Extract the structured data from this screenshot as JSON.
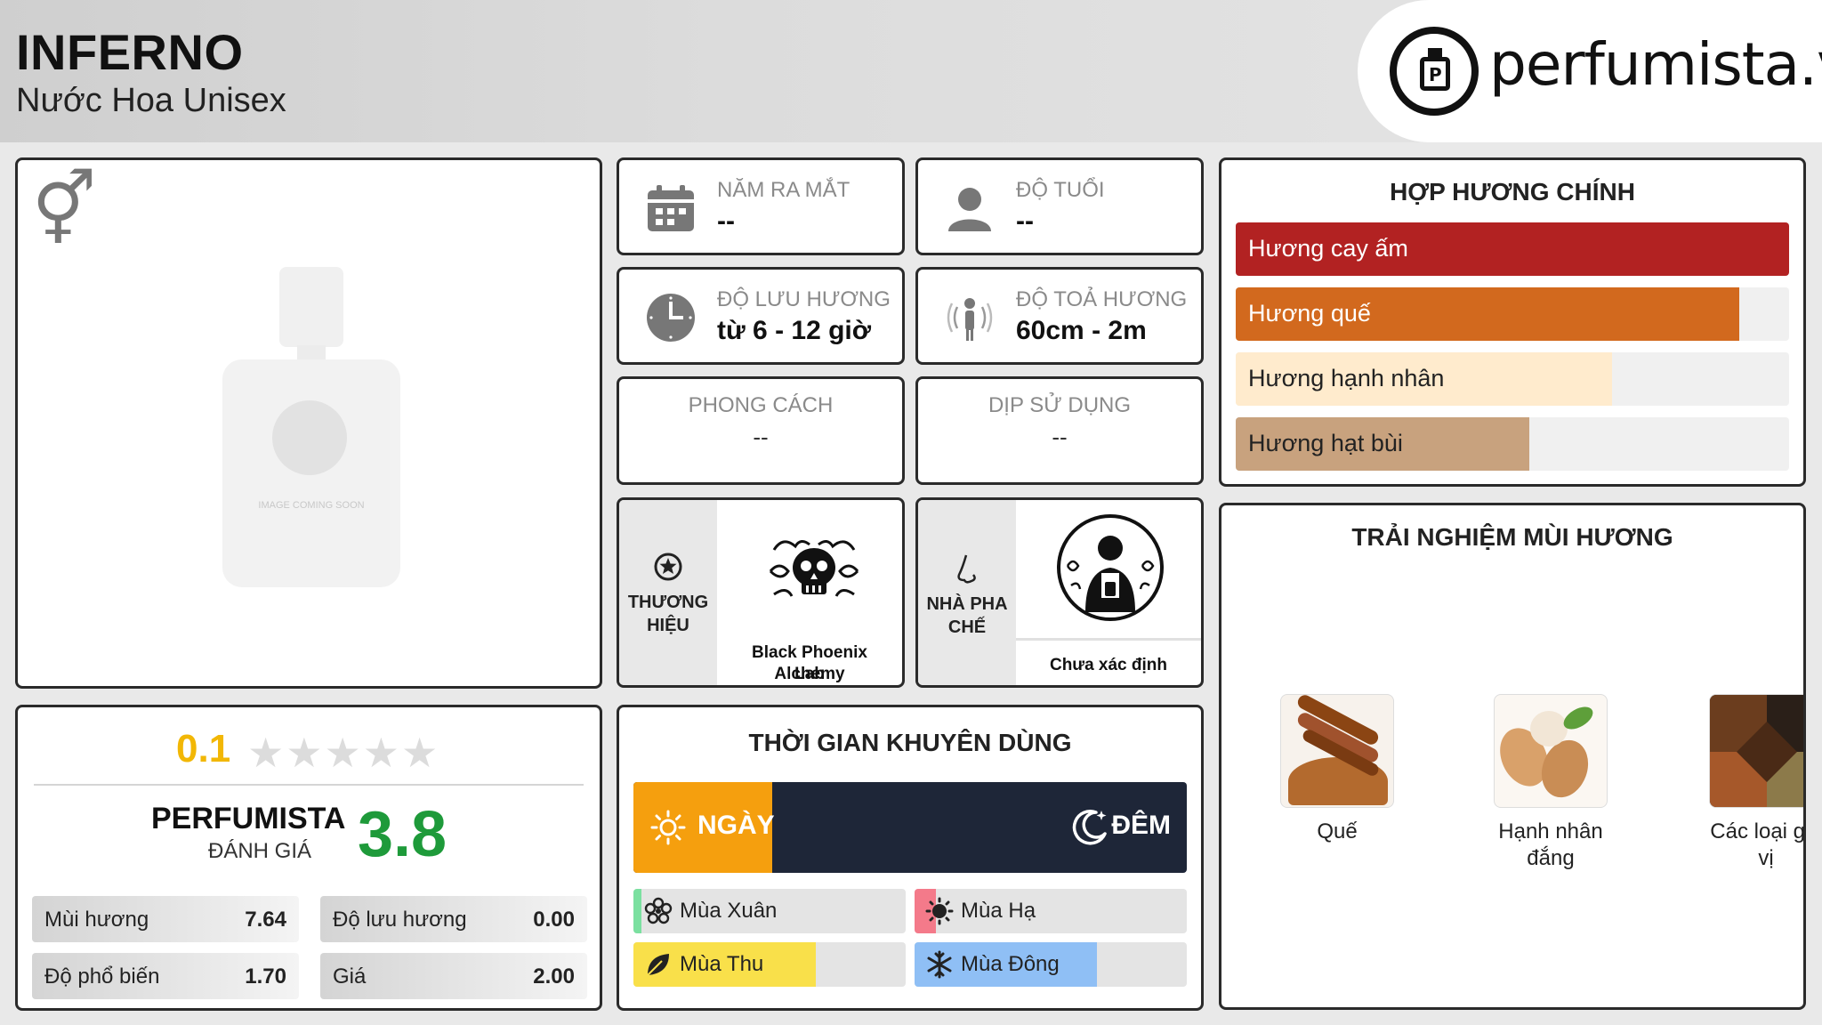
{
  "header": {
    "title": "INFERNO",
    "subtitle": "Nước Hoa Unisex",
    "brand": "perfumista.vn"
  },
  "product": {
    "gender_icon": "unisex-gender-icon",
    "image_label": "IMAGE COMING SOON"
  },
  "info": {
    "year": {
      "label": "NĂM RA MẮT",
      "value": "--"
    },
    "age": {
      "label": "ĐỘ TUỔI",
      "value": "--"
    },
    "longevity": {
      "label": "ĐỘ LƯU HƯƠNG",
      "value": "từ 6 - 12 giờ"
    },
    "sillage": {
      "label": "ĐỘ TOẢ HƯƠNG",
      "value": "60cm - 2m"
    },
    "style": {
      "label": "PHONG CÁCH",
      "value": "--"
    },
    "occasion": {
      "label": "DỊP SỬ DỤNG",
      "value": "--"
    },
    "brand": {
      "label_line1": "THƯƠNG",
      "label_line2": "HIỆU",
      "name_line1": "Black Phoenix Alchemy",
      "name_line2": "Lab"
    },
    "perfumer": {
      "label_line1": "NHÀ PHA",
      "label_line2": "CHẾ",
      "name": "Chưa xác định"
    }
  },
  "accords": {
    "title": "HỢP HƯƠNG CHÍNH",
    "items": [
      {
        "label": "Hương cay ấm",
        "level": 1.0,
        "color": "#b22222",
        "text_color": "#ffffff"
      },
      {
        "label": "Hương quế",
        "level": 0.91,
        "color": "#d2691e",
        "text_color": "#ffffff"
      },
      {
        "label": "Hương hạnh nhân",
        "level": 0.68,
        "color": "#ffebcd",
        "text_color": "#222222"
      },
      {
        "label": "Hương hạt bùi",
        "level": 0.53,
        "color": "#c8a27e",
        "text_color": "#222222"
      }
    ]
  },
  "experience": {
    "title": "TRẢI NGHIỆM MÙI HƯƠNG",
    "items": [
      {
        "label_line1": "Quế",
        "label_line2": ""
      },
      {
        "label_line1": "Hạnh nhân",
        "label_line2": "đắng"
      },
      {
        "label_line1": "Các loại gia",
        "label_line2": "vị"
      }
    ]
  },
  "rating": {
    "user_score": "0.1",
    "stars": "★★★★★",
    "pf_title": "PERFUMISTA",
    "pf_sub": "ĐÁNH GIÁ",
    "pf_score": "3.8",
    "metrics": [
      {
        "label": "Mùi hương",
        "value": "7.64"
      },
      {
        "label": "Độ lưu hương",
        "value": "0.00"
      },
      {
        "label": "Độ phổ biến",
        "value": "1.70"
      },
      {
        "label": "Giá",
        "value": "2.00"
      }
    ]
  },
  "time": {
    "title": "THỜI GIAN KHUYÊN DÙNG",
    "day": "NGÀY",
    "night": "ĐÊM",
    "day_level": 0.25,
    "seasons": [
      {
        "label": "Mùa Xuân",
        "level": 0.03,
        "color": "#7be0a0"
      },
      {
        "label": "Mùa Hạ",
        "level": 0.08,
        "color": "#f47a8a"
      },
      {
        "label": "Mùa Thu",
        "level": 0.67,
        "color": "#f9e04a"
      },
      {
        "label": "Mùa Đông",
        "level": 0.67,
        "color": "#8fbff5"
      }
    ]
  }
}
